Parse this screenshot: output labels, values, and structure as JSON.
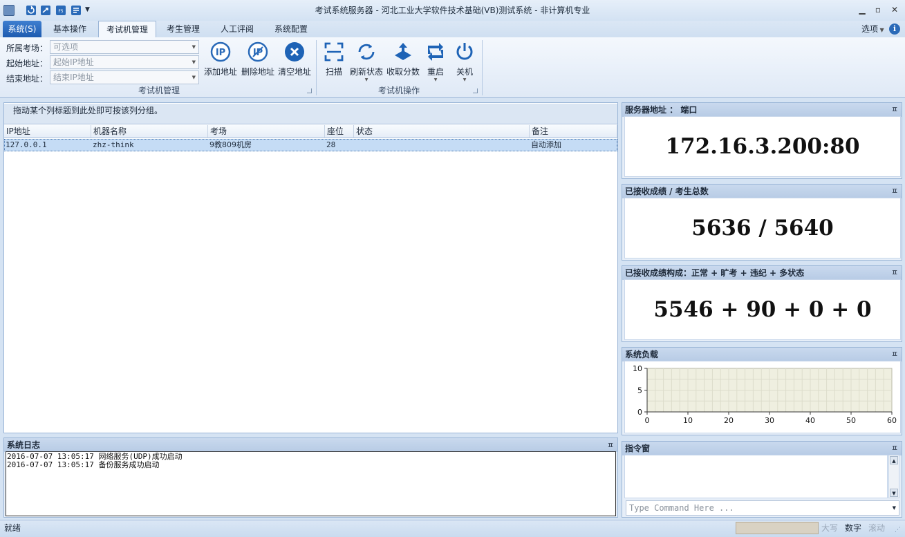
{
  "window": {
    "title": "考试系统服务器 - 河北工业大学软件技术基础(VB)测试系统 - 非计算机专业"
  },
  "quick_access": {
    "icons": [
      "app-icon",
      "refresh-icon",
      "export-icon",
      "tools-icon",
      "edit-icon"
    ]
  },
  "tabs": [
    {
      "label": "系统(S)"
    },
    {
      "label": "基本操作"
    },
    {
      "label": "考试机管理"
    },
    {
      "label": "考生管理"
    },
    {
      "label": "人工评阅"
    },
    {
      "label": "系统配置"
    }
  ],
  "options_label": "选项",
  "ribbon": {
    "group1": {
      "label": "考试机管理",
      "fields": [
        {
          "label": "所属考场：",
          "value": "可选项"
        },
        {
          "label": "起始地址：",
          "value": "起始IP地址"
        },
        {
          "label": "结束地址：",
          "value": "结束IP地址"
        }
      ],
      "buttons": [
        "添加地址",
        "删除地址",
        "清空地址"
      ]
    },
    "group2": {
      "label": "考试机操作",
      "buttons": [
        "扫描",
        "刷新状态",
        "收取分数",
        "重启",
        "关机"
      ]
    }
  },
  "grid": {
    "group_hint": "拖动某个列标题到此处即可按该列分组。",
    "columns": [
      "IP地址",
      "机器名称",
      "考场",
      "座位",
      "状态",
      "备注"
    ],
    "rows": [
      {
        "ip": "127.0.0.1",
        "machine": "zhz-think",
        "room": "9教809机房",
        "seat": "28",
        "status": "",
        "note": "自动添加"
      }
    ]
  },
  "log": {
    "title": "系统日志",
    "lines": [
      "2016-07-07 13:05:17 网络服务(UDP)成功启动",
      "2016-07-07 13:05:17 备份服务成功启动"
    ]
  },
  "right_panels": {
    "server": {
      "title": "服务器地址 ： 端口",
      "value": "172.16.3.200:80"
    },
    "received": {
      "title": "已接收成绩 / 考生总数",
      "value": "5636 / 5640"
    },
    "composition": {
      "title": "已接收成绩构成：正常 + 旷考 + 违纪 + 多状态",
      "value": "5546 + 90 + 0 + 0"
    },
    "load": {
      "title": "系统负载"
    },
    "command": {
      "title": "指令窗",
      "placeholder": "Type Command Here ..."
    }
  },
  "chart_data": {
    "type": "line",
    "x": [],
    "series": [],
    "xlim": [
      0,
      60
    ],
    "ylim": [
      0,
      10
    ],
    "x_ticks": [
      "0",
      "10",
      "20",
      "30",
      "40",
      "50",
      "60"
    ],
    "y_ticks": [
      "10",
      "5",
      "0"
    ],
    "grid": true
  },
  "status": {
    "left": "就绪",
    "indicators": [
      "大写",
      "数字",
      "滚动"
    ]
  },
  "colors": {
    "accent": "#1d5bb0",
    "panel_header": "#c4d6ec",
    "selection": "#c5dcf5"
  }
}
